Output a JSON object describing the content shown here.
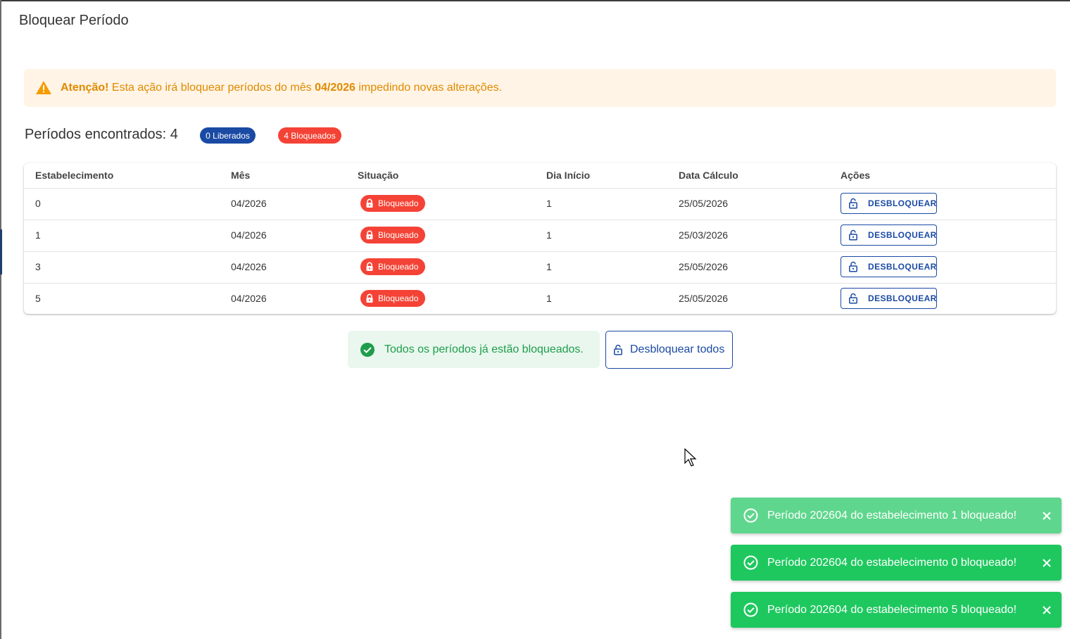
{
  "dialog": {
    "title": "Bloquear Período"
  },
  "alert": {
    "strong": "Atenção!",
    "text_before": " Esta ação irá bloquear períodos do mês ",
    "month": "04/2026",
    "text_after": " impedindo novas alterações.",
    "color": "#e08a00",
    "icon": "warning-icon"
  },
  "summary": {
    "heading": "Períodos encontrados: 4",
    "released_chip": "0 Liberados",
    "blocked_chip": "4 Bloqueados"
  },
  "table": {
    "headers": [
      "Estabelecimento",
      "Mês",
      "Situação",
      "Dia Início",
      "Data Cálculo",
      "Ações"
    ],
    "rows": [
      {
        "estabelecimento": "0",
        "mes": "04/2026",
        "situacao": "Bloqueado",
        "dia_inicio": "1",
        "data_calculo": "25/05/2026",
        "acao": "DESBLOQUEAR"
      },
      {
        "estabelecimento": "1",
        "mes": "04/2026",
        "situacao": "Bloqueado",
        "dia_inicio": "1",
        "data_calculo": "25/03/2026",
        "acao": "DESBLOQUEAR"
      },
      {
        "estabelecimento": "3",
        "mes": "04/2026",
        "situacao": "Bloqueado",
        "dia_inicio": "1",
        "data_calculo": "25/05/2026",
        "acao": "DESBLOQUEAR"
      },
      {
        "estabelecimento": "5",
        "mes": "04/2026",
        "situacao": "Bloqueado",
        "dia_inicio": "1",
        "data_calculo": "25/05/2026",
        "acao": "DESBLOQUEAR"
      }
    ]
  },
  "footer": {
    "success_message": "Todos os períodos já estão bloqueados.",
    "unlock_all_label": "Desbloquear todos"
  },
  "toasts": [
    {
      "message": "Período 202604 do estabelecimento 1 bloqueado!",
      "style": "faded"
    },
    {
      "message": "Período 202604 do estabelecimento 0 bloqueado!",
      "style": "solid"
    },
    {
      "message": "Período 202604 do estabelecimento 5 bloqueado!",
      "style": "solid"
    }
  ],
  "colors": {
    "primary": "#1a4aa3",
    "danger": "#f44336",
    "success": "#1ec85f",
    "warning_bg": "#fff4e5"
  }
}
